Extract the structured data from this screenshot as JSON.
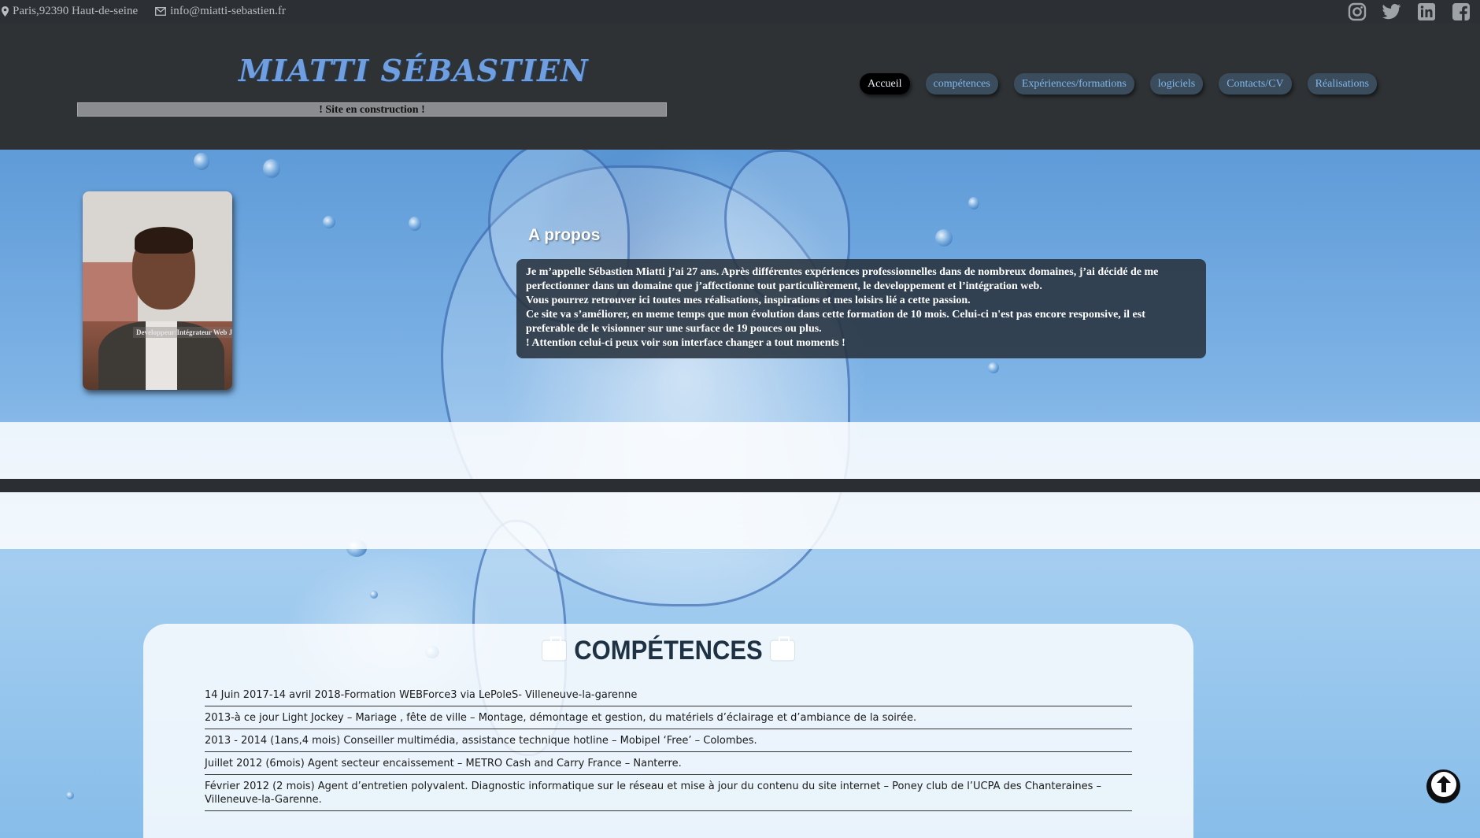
{
  "topbar": {
    "location": "Paris,92390 Haut-de-seine",
    "email": "info@miatti-sebastien.fr",
    "location_icon": "map-marker-icon",
    "email_icon": "envelope-icon",
    "social": [
      "instagram-icon",
      "twitter-icon",
      "linkedin-icon",
      "facebook-icon"
    ]
  },
  "header": {
    "brand": "MIATTI SÉBASTIEN",
    "construction": "! Site en construction !",
    "nav": [
      {
        "label": "Accueil",
        "active": true
      },
      {
        "label": "compétences"
      },
      {
        "label": "Expériences/formations"
      },
      {
        "label": "logiciels"
      },
      {
        "label": "Contacts/CV"
      },
      {
        "label": "Réalisations"
      }
    ]
  },
  "profile": {
    "caption": "Developpeur/Intégrateur Web Junior"
  },
  "about": {
    "title": "A propos",
    "lines": [
      "Je m’appelle Sébastien Miatti j’ai 27 ans. Après différentes expériences professionnelles dans de nombreux domaines, j’ai décidé de me perfectionner dans un domaine que j’affectionne tout particulièrement, le developpement et l’intégration web.",
      "Vous pourrez retrouver ici toutes mes réalisations, inspirations et mes loisirs lié a cette passion.",
      "Ce site va s’améliorer, en meme temps que mon évolution dans cette formation de 10 mois. Celui-ci n'est pas encore responsive, il est preferable de le visionner sur une surface de 19 pouces ou plus.",
      "! Attention celui-ci peux voir son interface changer a tout moments !"
    ]
  },
  "competences": {
    "title": "COMPÉTENCES",
    "items": [
      "14 Juin 2017-14 avril 2018-Formation WEBForce3 via LePoleS- Villeneuve-la-garenne",
      "2013-à ce jour Light Jockey – Mariage , fête de ville – Montage, démontage et gestion, du matériels d’éclairage et d’ambiance de la soirée.",
      "2013 - 2014 (1ans,4 mois) Conseiller multimédia, assistance technique hotline – Mobipel ‘Free’ – Colombes.",
      "Juillet 2012 (6mois) Agent secteur encaissement – METRO Cash and Carry France – Nanterre.",
      "Février 2012 (2 mois) Agent d’entretien polyvalent. Diagnostic informatique sur le réseau et mise à jour du contenu du site internet – Poney club de l’UCPA des Chanteraines – Villeneuve-la-Garenne."
    ]
  },
  "scroll_icon": "arrow-up-circle-icon"
}
